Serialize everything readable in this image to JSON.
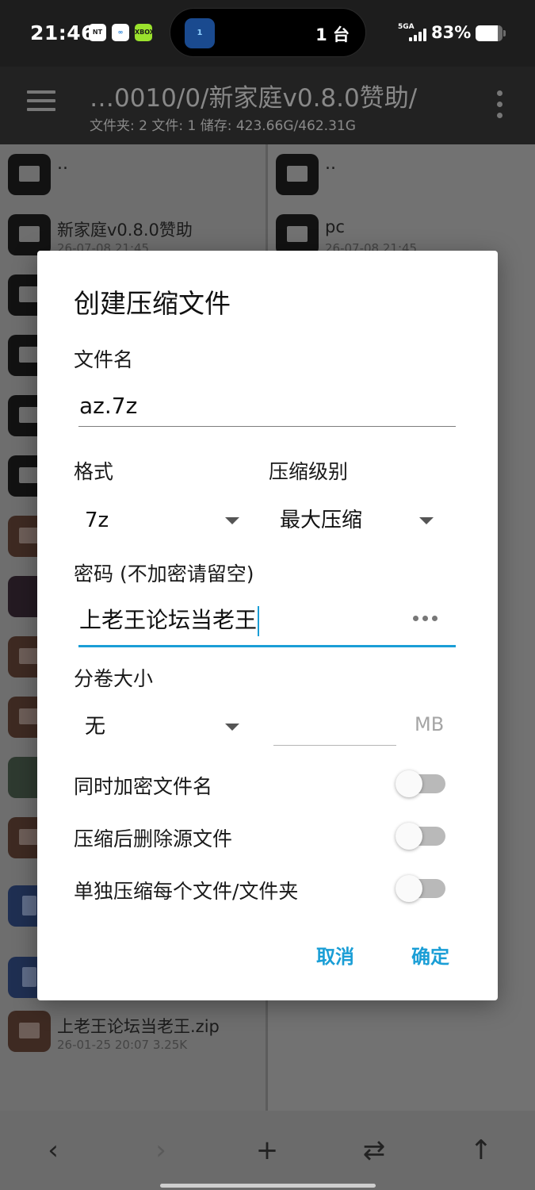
{
  "status_bar": {
    "time": "21:46",
    "app_icons": [
      {
        "name": "news-app-icon",
        "text": "NT",
        "bg": "#ffffff",
        "fg": "#222222"
      },
      {
        "name": "cloud-app-icon",
        "text": "∞",
        "bg": "#ffffff",
        "fg": "#1a7ad6"
      },
      {
        "name": "xbox-app-icon",
        "text": "XBOX",
        "bg": "#9be22d",
        "fg": "#1a1a1a"
      }
    ],
    "island_icon_text": "1",
    "island_text": "1 台",
    "network": "5GA",
    "battery": "83%",
    "battery_level": 0.83
  },
  "app_bar": {
    "path": "…0010/0/新家庭v0.8.0赞助/",
    "summary": "文件夹: 2  文件: 1  储存: 423.66G/462.31G"
  },
  "left_pane": {
    "parent": "..",
    "visible_items": [
      {
        "name": "新家庭v0.8.0赞助",
        "meta": "26-07-08 21:45"
      },
      {
        "name": "上老王论坛当老王.zip",
        "meta": "26-01-25 20:07  3.25K"
      }
    ]
  },
  "right_pane": {
    "parent": "..",
    "visible_items": [
      {
        "name": "pc",
        "meta": "26-07-08 21:45"
      }
    ]
  },
  "dialog": {
    "title": "创建压缩文件",
    "filename_label": "文件名",
    "filename_value": "az.7z",
    "format_label": "格式",
    "format_value": "7z",
    "level_label": "压缩级别",
    "level_value": "最大压缩",
    "password_label": "密码 (不加密请留空)",
    "password_value": "上老王论坛当老王",
    "volume_label": "分卷大小",
    "volume_value": "无",
    "volume_unit": "MB",
    "options": [
      {
        "label": "同时加密文件名",
        "on": false
      },
      {
        "label": "压缩后删除源文件",
        "on": false
      },
      {
        "label": "单独压缩每个文件/文件夹",
        "on": false
      }
    ],
    "cancel": "取消",
    "ok": "确定",
    "accent_color": "#1a9ed6"
  },
  "toolbar": {
    "back": "‹",
    "forward": "›",
    "add": "+",
    "swap": "⇄",
    "up": "↑"
  }
}
